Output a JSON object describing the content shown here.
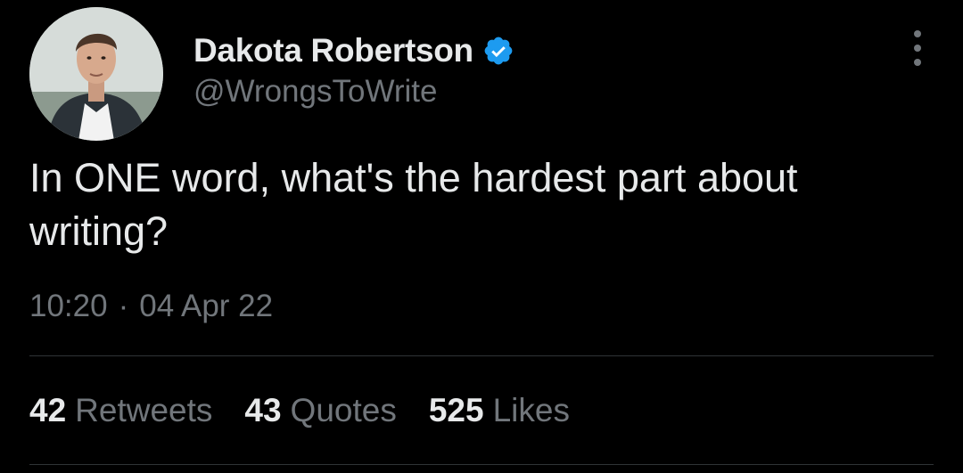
{
  "author": {
    "display_name": "Dakota Robertson",
    "handle": "@WrongsToWrite",
    "verified": true,
    "verified_color": "#1d9bf0"
  },
  "tweet": {
    "text": "In ONE word, what's the hardest part about writing?",
    "time": "10:20",
    "separator": "·",
    "date": "04 Apr 22"
  },
  "stats": [
    {
      "count": "42",
      "label": "Retweets"
    },
    {
      "count": "43",
      "label": "Quotes"
    },
    {
      "count": "525",
      "label": "Likes"
    }
  ],
  "icons": {
    "more": "more-options-icon",
    "verified": "verified-badge-icon"
  },
  "colors": {
    "background": "#000000",
    "primary_text": "#e7e9ea",
    "secondary_text": "#71767b",
    "divider": "#2f3336"
  }
}
